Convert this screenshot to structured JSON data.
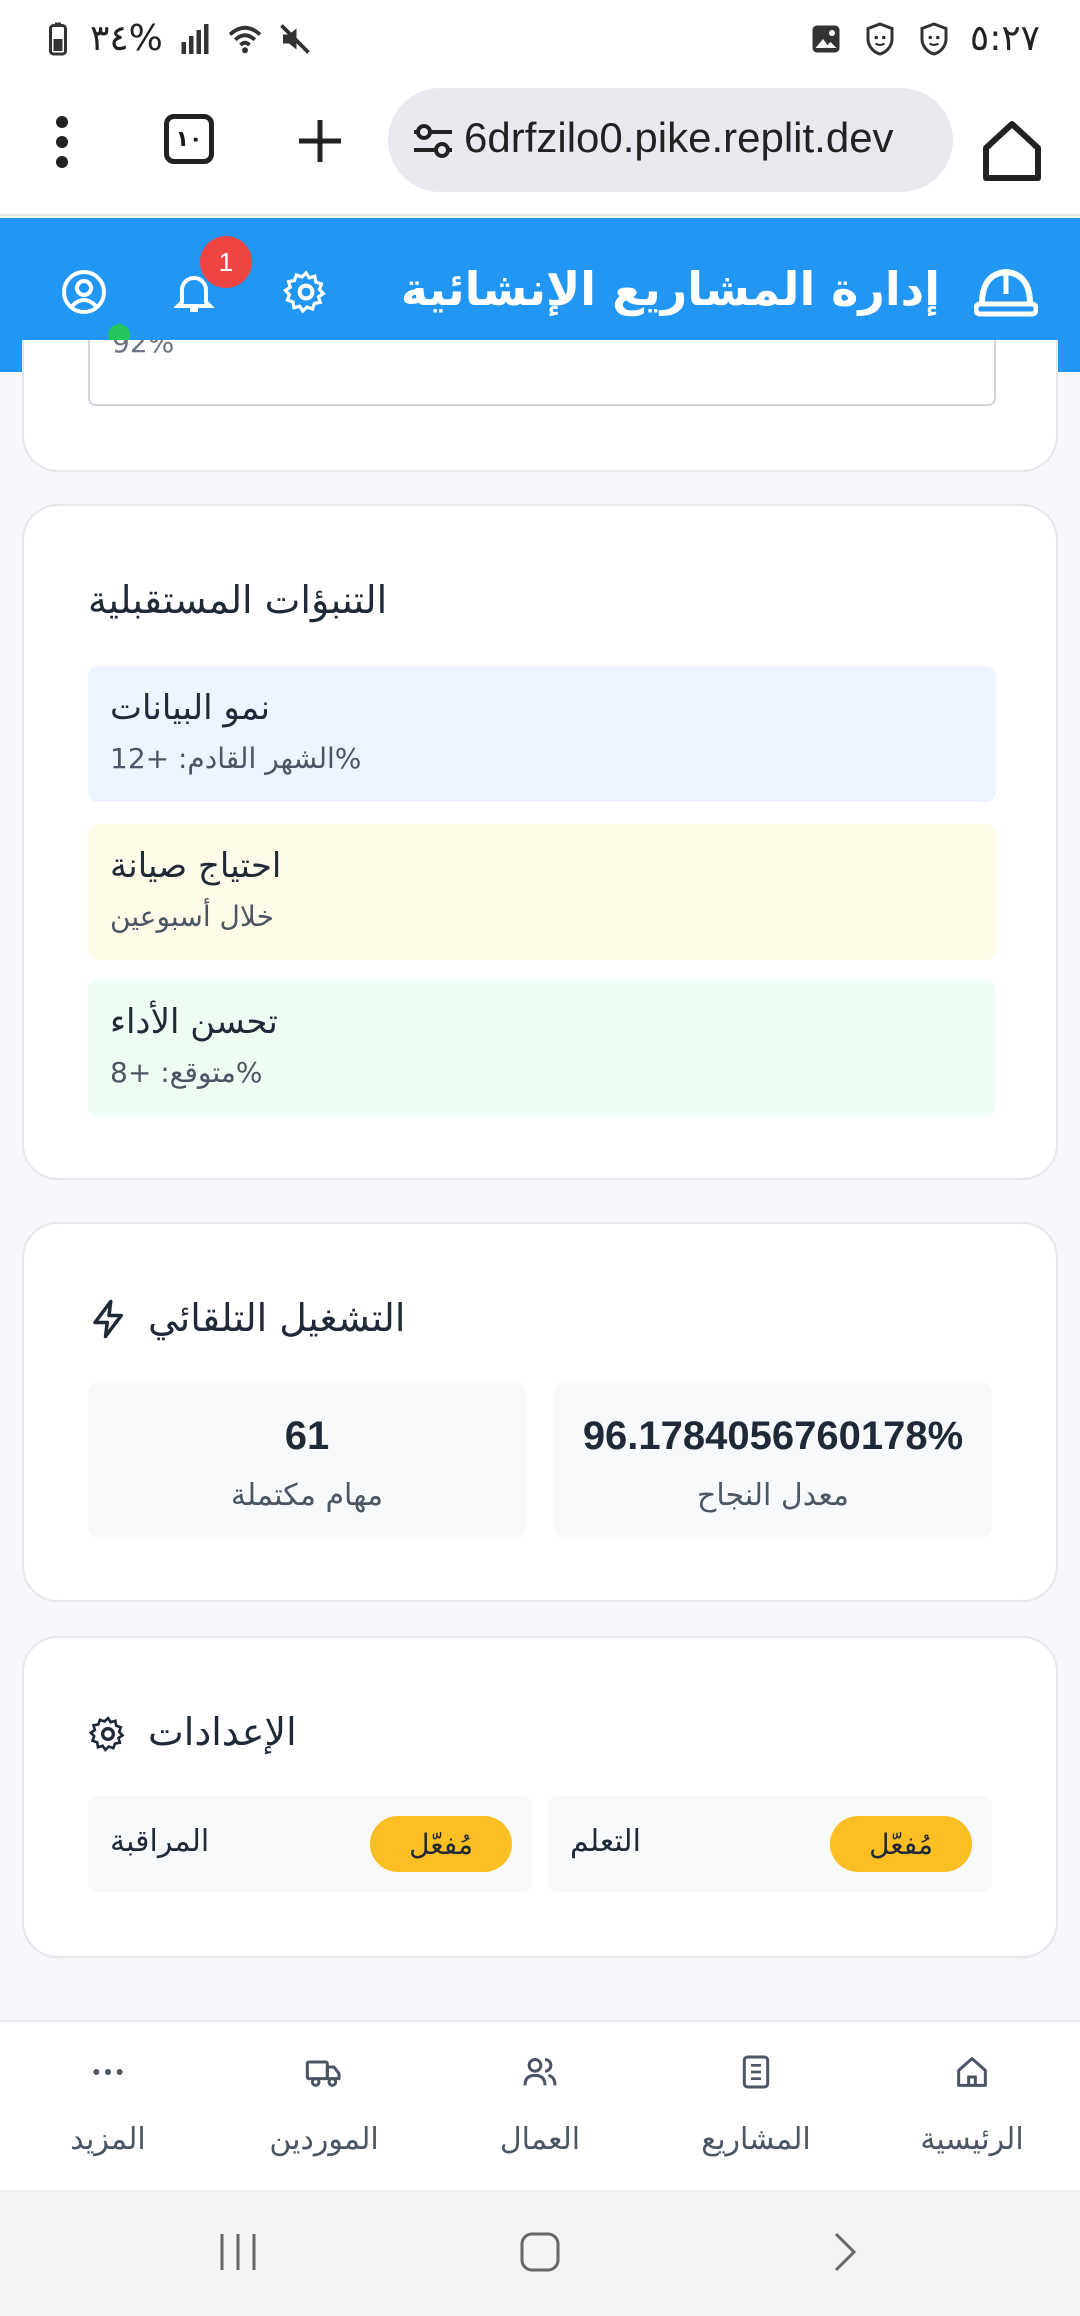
{
  "status_bar": {
    "battery": "٣٤%",
    "time": "٥:٢٧"
  },
  "browser": {
    "url": "6drfzilo0.pike.replit.dev",
    "tab_count": "١٠"
  },
  "header": {
    "title": "إدارة المشاريع الإنشائية",
    "notification_count": "1"
  },
  "partial_card": {
    "clipped_text": "92%"
  },
  "predictions": {
    "title": "التنبؤات المستقبلية",
    "items": [
      {
        "title": "نمو البيانات",
        "subtitle": "%الشهر القادم: +12",
        "bg": "#eef4ff"
      },
      {
        "title": "احتياج صيانة",
        "subtitle": "خلال أسبوعين",
        "bg": "#fefbe8"
      },
      {
        "title": "تحسن الأداء",
        "subtitle": "%متوقع: +8",
        "bg": "#edfdf3"
      }
    ]
  },
  "automation": {
    "title": "التشغيل التلقائي",
    "success_rate": {
      "value": "96.1784056760178%",
      "label": "معدل النجاح"
    },
    "completed": {
      "value": "61",
      "label": "مهام مكتملة"
    }
  },
  "settings": {
    "title": "الإعدادات",
    "items": [
      {
        "name": "التعلم",
        "state": "مُفعّل"
      },
      {
        "name": "المراقبة",
        "state": "مُفعّل"
      }
    ]
  },
  "bottom_nav": {
    "items": [
      {
        "label": "الرئيسية",
        "icon": "home-icon"
      },
      {
        "label": "المشاريع",
        "icon": "building-icon"
      },
      {
        "label": "العمال",
        "icon": "users-icon"
      },
      {
        "label": "الموردين",
        "icon": "truck-icon"
      },
      {
        "label": "المزيد",
        "icon": "more-icon"
      }
    ]
  },
  "colors": {
    "primary": "#2196f3",
    "badge": "#ef4444",
    "toggle_on": "#fbbf24",
    "online": "#22c55e"
  }
}
